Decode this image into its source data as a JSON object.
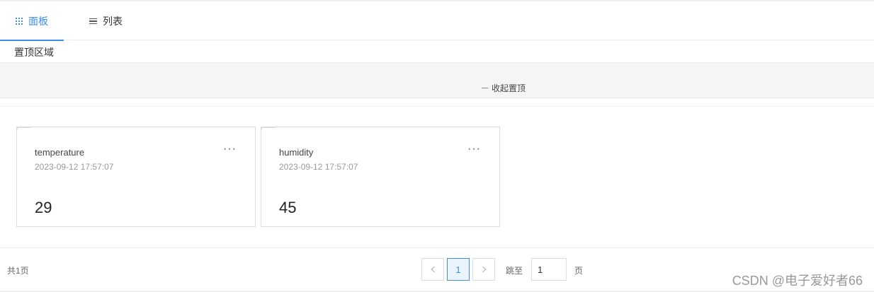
{
  "tabs": [
    {
      "label": "面板",
      "icon": "grid-icon",
      "active": true
    },
    {
      "label": "列表",
      "icon": "list-icon",
      "active": false
    }
  ],
  "pinned": {
    "title": "置顶区域",
    "collapse_label": "收起置顶"
  },
  "cards": [
    {
      "name": "temperature",
      "time": "2023-09-12 17:57:07",
      "value": "29",
      "more": "···"
    },
    {
      "name": "humidity",
      "time": "2023-09-12 17:57:07",
      "value": "45",
      "more": "···"
    }
  ],
  "pagination": {
    "total_label": "共1页",
    "current_page": "1",
    "jump_label": "跳至",
    "jump_value": "1",
    "page_suffix": "页"
  },
  "watermark": "CSDN @电子爱好者66",
  "colors": {
    "accent": "#3a8ee6",
    "pinned_bg": "#f5f5f5"
  }
}
